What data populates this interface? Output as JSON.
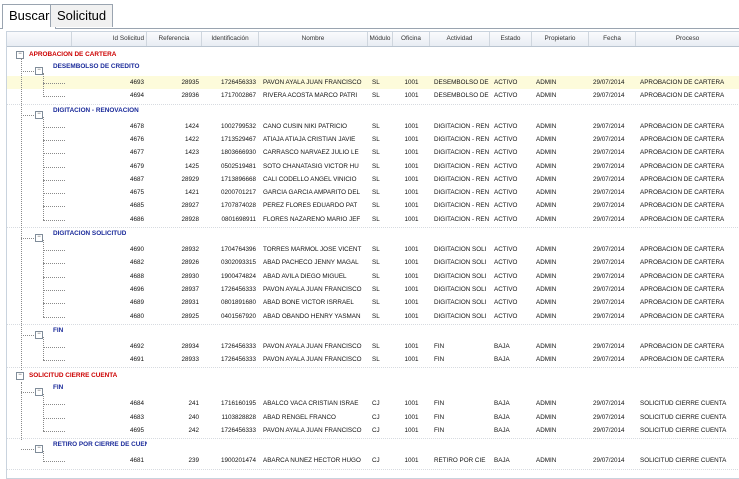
{
  "tabs": [
    {
      "label": "Buscar",
      "active": true
    },
    {
      "label": "Solicitud",
      "active": false
    }
  ],
  "columns": [
    "Id Solicitud",
    "Referencia",
    "Identificación",
    "Nombre",
    "Módulo",
    "Oficina",
    "Actividad",
    "Estado",
    "Propietario",
    "Fecha",
    "Proceso"
  ],
  "tree": [
    {
      "label": "APROBACION DE CARTERA",
      "level": 0,
      "expanded": true
    },
    {
      "label": "DESEMBOLSO DE CREDITO",
      "level": 1,
      "expanded": true,
      "rows": [
        {
          "id": "4693",
          "ref": "28935",
          "ident": "1726456333",
          "nombre": "PAVON AYALA JUAN FRANCISCO",
          "modulo": "SL",
          "oficina": "1001",
          "actividad": "DESEMBOLSO DE",
          "estado": "ACTIVO",
          "propietario": "ADMIN",
          "fecha": "29/07/2014",
          "proceso": "APROBACION DE CARTERA",
          "selected": true
        },
        {
          "id": "4694",
          "ref": "28936",
          "ident": "1717002867",
          "nombre": "RIVERA ACOSTA MARCO PATRI",
          "modulo": "SL",
          "oficina": "1001",
          "actividad": "DESEMBOLSO DE",
          "estado": "ACTIVO",
          "propietario": "ADMIN",
          "fecha": "29/07/2014",
          "proceso": "APROBACION DE CARTERA"
        }
      ]
    },
    {
      "label": "DIGITACION - RENOVACION",
      "level": 1,
      "expanded": true,
      "rows": [
        {
          "id": "4678",
          "ref": "1424",
          "ident": "1002799532",
          "nombre": "CANO CUSIN NIKI PATRICIO",
          "modulo": "SL",
          "oficina": "1001",
          "actividad": "DIGITACION - REN",
          "estado": "ACTIVO",
          "propietario": "ADMIN",
          "fecha": "29/07/2014",
          "proceso": "APROBACION DE CARTERA"
        },
        {
          "id": "4676",
          "ref": "1422",
          "ident": "1713529467",
          "nombre": "ATIAJA ATIAJA CRISTIAN JAVIE",
          "modulo": "SL",
          "oficina": "1001",
          "actividad": "DIGITACION - REN",
          "estado": "ACTIVO",
          "propietario": "ADMIN",
          "fecha": "29/07/2014",
          "proceso": "APROBACION DE CARTERA"
        },
        {
          "id": "4677",
          "ref": "1423",
          "ident": "1803666930",
          "nombre": "CARRASCO NARVAEZ JULIO LE",
          "modulo": "SL",
          "oficina": "1001",
          "actividad": "DIGITACION - REN",
          "estado": "ACTIVO",
          "propietario": "ADMIN",
          "fecha": "29/07/2014",
          "proceso": "APROBACION DE CARTERA"
        },
        {
          "id": "4679",
          "ref": "1425",
          "ident": "0502519481",
          "nombre": "SOTO CHANATASIG VICTOR HU",
          "modulo": "SL",
          "oficina": "1001",
          "actividad": "DIGITACION - REN",
          "estado": "ACTIVO",
          "propietario": "ADMIN",
          "fecha": "29/07/2014",
          "proceso": "APROBACION DE CARTERA"
        },
        {
          "id": "4687",
          "ref": "28929",
          "ident": "1713896668",
          "nombre": "CALI CODELLO ANGEL VINICIO",
          "modulo": "SL",
          "oficina": "1001",
          "actividad": "DIGITACION - REN",
          "estado": "ACTIVO",
          "propietario": "ADMIN",
          "fecha": "29/07/2014",
          "proceso": "APROBACION DE CARTERA"
        },
        {
          "id": "4675",
          "ref": "1421",
          "ident": "0200701217",
          "nombre": "GARCIA GARCIA AMPARITO DEL",
          "modulo": "SL",
          "oficina": "1001",
          "actividad": "DIGITACION - REN",
          "estado": "ACTIVO",
          "propietario": "ADMIN",
          "fecha": "29/07/2014",
          "proceso": "APROBACION DE CARTERA"
        },
        {
          "id": "4685",
          "ref": "28927",
          "ident": "1707874028",
          "nombre": "PEREZ FLORES EDUARDO PAT",
          "modulo": "SL",
          "oficina": "1001",
          "actividad": "DIGITACION - REN",
          "estado": "ACTIVO",
          "propietario": "ADMIN",
          "fecha": "29/07/2014",
          "proceso": "APROBACION DE CARTERA"
        },
        {
          "id": "4686",
          "ref": "28928",
          "ident": "0801698911",
          "nombre": "FLORES NAZARENO MARIO JEF",
          "modulo": "SL",
          "oficina": "1001",
          "actividad": "DIGITACION - REN",
          "estado": "ACTIVO",
          "propietario": "ADMIN",
          "fecha": "29/07/2014",
          "proceso": "APROBACION DE CARTERA"
        }
      ]
    },
    {
      "label": "DIGITACION SOLICITUD",
      "level": 1,
      "expanded": true,
      "rows": [
        {
          "id": "4690",
          "ref": "28932",
          "ident": "1704764396",
          "nombre": "TORRES MARMOL JOSE VICENT",
          "modulo": "SL",
          "oficina": "1001",
          "actividad": "DIGITACION SOLI",
          "estado": "ACTIVO",
          "propietario": "ADMIN",
          "fecha": "29/07/2014",
          "proceso": "APROBACION DE CARTERA"
        },
        {
          "id": "4682",
          "ref": "28926",
          "ident": "0302093315",
          "nombre": "ABAD PACHECO JENNY MAGAL",
          "modulo": "SL",
          "oficina": "1001",
          "actividad": "DIGITACION SOLI",
          "estado": "ACTIVO",
          "propietario": "ADMIN",
          "fecha": "29/07/2014",
          "proceso": "APROBACION DE CARTERA"
        },
        {
          "id": "4688",
          "ref": "28930",
          "ident": "1900474824",
          "nombre": "ABAD AVILA DIEGO MIGUEL",
          "modulo": "SL",
          "oficina": "1001",
          "actividad": "DIGITACION SOLI",
          "estado": "ACTIVO",
          "propietario": "ADMIN",
          "fecha": "29/07/2014",
          "proceso": "APROBACION DE CARTERA"
        },
        {
          "id": "4696",
          "ref": "28937",
          "ident": "1726456333",
          "nombre": "PAVON AYALA JUAN FRANCISCO",
          "modulo": "SL",
          "oficina": "1001",
          "actividad": "DIGITACION SOLI",
          "estado": "ACTIVO",
          "propietario": "ADMIN",
          "fecha": "29/07/2014",
          "proceso": "APROBACION DE CARTERA"
        },
        {
          "id": "4689",
          "ref": "28931",
          "ident": "0801891680",
          "nombre": "ABAD BONE VICTOR ISRRAEL",
          "modulo": "SL",
          "oficina": "1001",
          "actividad": "DIGITACION SOLI",
          "estado": "ACTIVO",
          "propietario": "ADMIN",
          "fecha": "29/07/2014",
          "proceso": "APROBACION DE CARTERA"
        },
        {
          "id": "4680",
          "ref": "28925",
          "ident": "0401567920",
          "nombre": "ABAD OBANDO HENRY YASMAN",
          "modulo": "SL",
          "oficina": "1001",
          "actividad": "DIGITACION SOLI",
          "estado": "ACTIVO",
          "propietario": "ADMIN",
          "fecha": "29/07/2014",
          "proceso": "APROBACION DE CARTERA"
        }
      ]
    },
    {
      "label": "FIN",
      "level": 1,
      "expanded": true,
      "rows": [
        {
          "id": "4692",
          "ref": "28934",
          "ident": "1726456333",
          "nombre": "PAVON AYALA JUAN FRANCISCO",
          "modulo": "SL",
          "oficina": "1001",
          "actividad": "FIN",
          "estado": "BAJA",
          "propietario": "ADMIN",
          "fecha": "29/07/2014",
          "proceso": "APROBACION DE CARTERA"
        },
        {
          "id": "4691",
          "ref": "28933",
          "ident": "1726456333",
          "nombre": "PAVON AYALA JUAN FRANCISCO",
          "modulo": "SL",
          "oficina": "1001",
          "actividad": "FIN",
          "estado": "BAJA",
          "propietario": "ADMIN",
          "fecha": "29/07/2014",
          "proceso": "APROBACION DE CARTERA"
        }
      ]
    },
    {
      "label": "SOLICITUD CIERRE CUENTA",
      "level": 0,
      "expanded": true
    },
    {
      "label": "FIN",
      "level": 1,
      "expanded": true,
      "rows": [
        {
          "id": "4684",
          "ref": "241",
          "ident": "1716160195",
          "nombre": "ABALCO VACA CRISTIAN ISRAE",
          "modulo": "CJ",
          "oficina": "1001",
          "actividad": "FIN",
          "estado": "BAJA",
          "propietario": "ADMIN",
          "fecha": "29/07/2014",
          "proceso": "SOLICITUD CIERRE CUENTA"
        },
        {
          "id": "4683",
          "ref": "240",
          "ident": "1103828828",
          "nombre": "ABAD RENGEL FRANCO",
          "modulo": "CJ",
          "oficina": "1001",
          "actividad": "FIN",
          "estado": "BAJA",
          "propietario": "ADMIN",
          "fecha": "29/07/2014",
          "proceso": "SOLICITUD CIERRE CUENTA"
        },
        {
          "id": "4695",
          "ref": "242",
          "ident": "1726456333",
          "nombre": "PAVON AYALA JUAN FRANCISCO",
          "modulo": "CJ",
          "oficina": "1001",
          "actividad": "FIN",
          "estado": "BAJA",
          "propietario": "ADMIN",
          "fecha": "29/07/2014",
          "proceso": "SOLICITUD CIERRE CUENTA"
        }
      ]
    },
    {
      "label": "RETIRO POR CIERRE DE CUENTA",
      "level": 1,
      "expanded": true,
      "rows": [
        {
          "id": "4681",
          "ref": "239",
          "ident": "1900201474",
          "nombre": "ABARCA NUNEZ HECTOR HUGO",
          "modulo": "CJ",
          "oficina": "1001",
          "actividad": "RETIRO POR CIE",
          "estado": "BAJA",
          "propietario": "ADMIN",
          "fecha": "29/07/2014",
          "proceso": "SOLICITUD CIERRE CUENTA"
        }
      ]
    }
  ],
  "colors": {
    "header_bg": "#eef1f5",
    "group_l0": "#cc0000",
    "group_l1": "#1a2a9a",
    "selected_row": "#fdfbdb",
    "border": "#9aa4b0"
  }
}
